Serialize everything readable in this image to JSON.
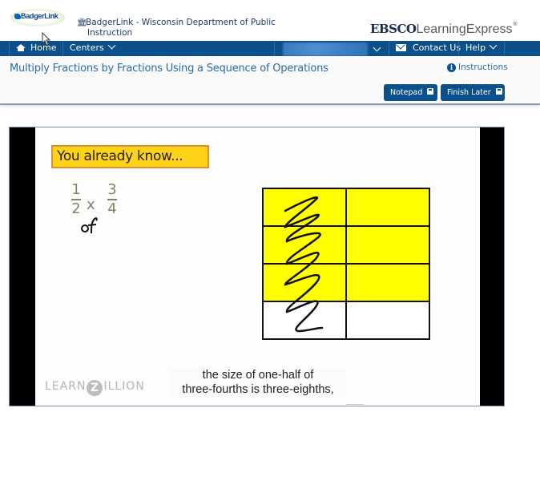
{
  "header": {
    "logo_text": "BadgerLink",
    "institution_title_line1": "BadgerLink - Wisconsin Department of Public",
    "institution_title_line2": "Instruction",
    "brand_bold": "EBSCO",
    "brand_light": "LearningExpress",
    "brand_mark": "®"
  },
  "nav": {
    "items": [
      {
        "label": "Home",
        "icon": "home-icon"
      },
      {
        "label": "Centers",
        "icon": "chevron-down-icon"
      },
      {
        "label": "",
        "icon": "chevron-down-icon",
        "note": "blurred user name"
      },
      {
        "label": "Contact Us",
        "icon": "mail-icon"
      },
      {
        "label": "Help",
        "icon": "chevron-down-icon"
      }
    ]
  },
  "lesson": {
    "title": "Multiply Fractions by Fractions Using a Sequence of Operations",
    "instructions_label": "Instructions",
    "notepad_label": "Notepad",
    "finish_later_label": "Finish Later"
  },
  "video": {
    "banner": "You already know...",
    "fraction_a": {
      "num": "1",
      "den": "2"
    },
    "operator": "x",
    "handwritten": "of",
    "fraction_b": {
      "num": "3",
      "den": "4"
    },
    "grid": {
      "rows": 4,
      "cols": 2,
      "shaded_rows": 3,
      "shade_color": "#ffff00"
    },
    "watermark_left": "LEARN",
    "watermark_z": "Z",
    "watermark_right": "ILLION",
    "caption_line1": "the size of one-half of",
    "caption_line2": "three-fourths is three-eighths,"
  }
}
